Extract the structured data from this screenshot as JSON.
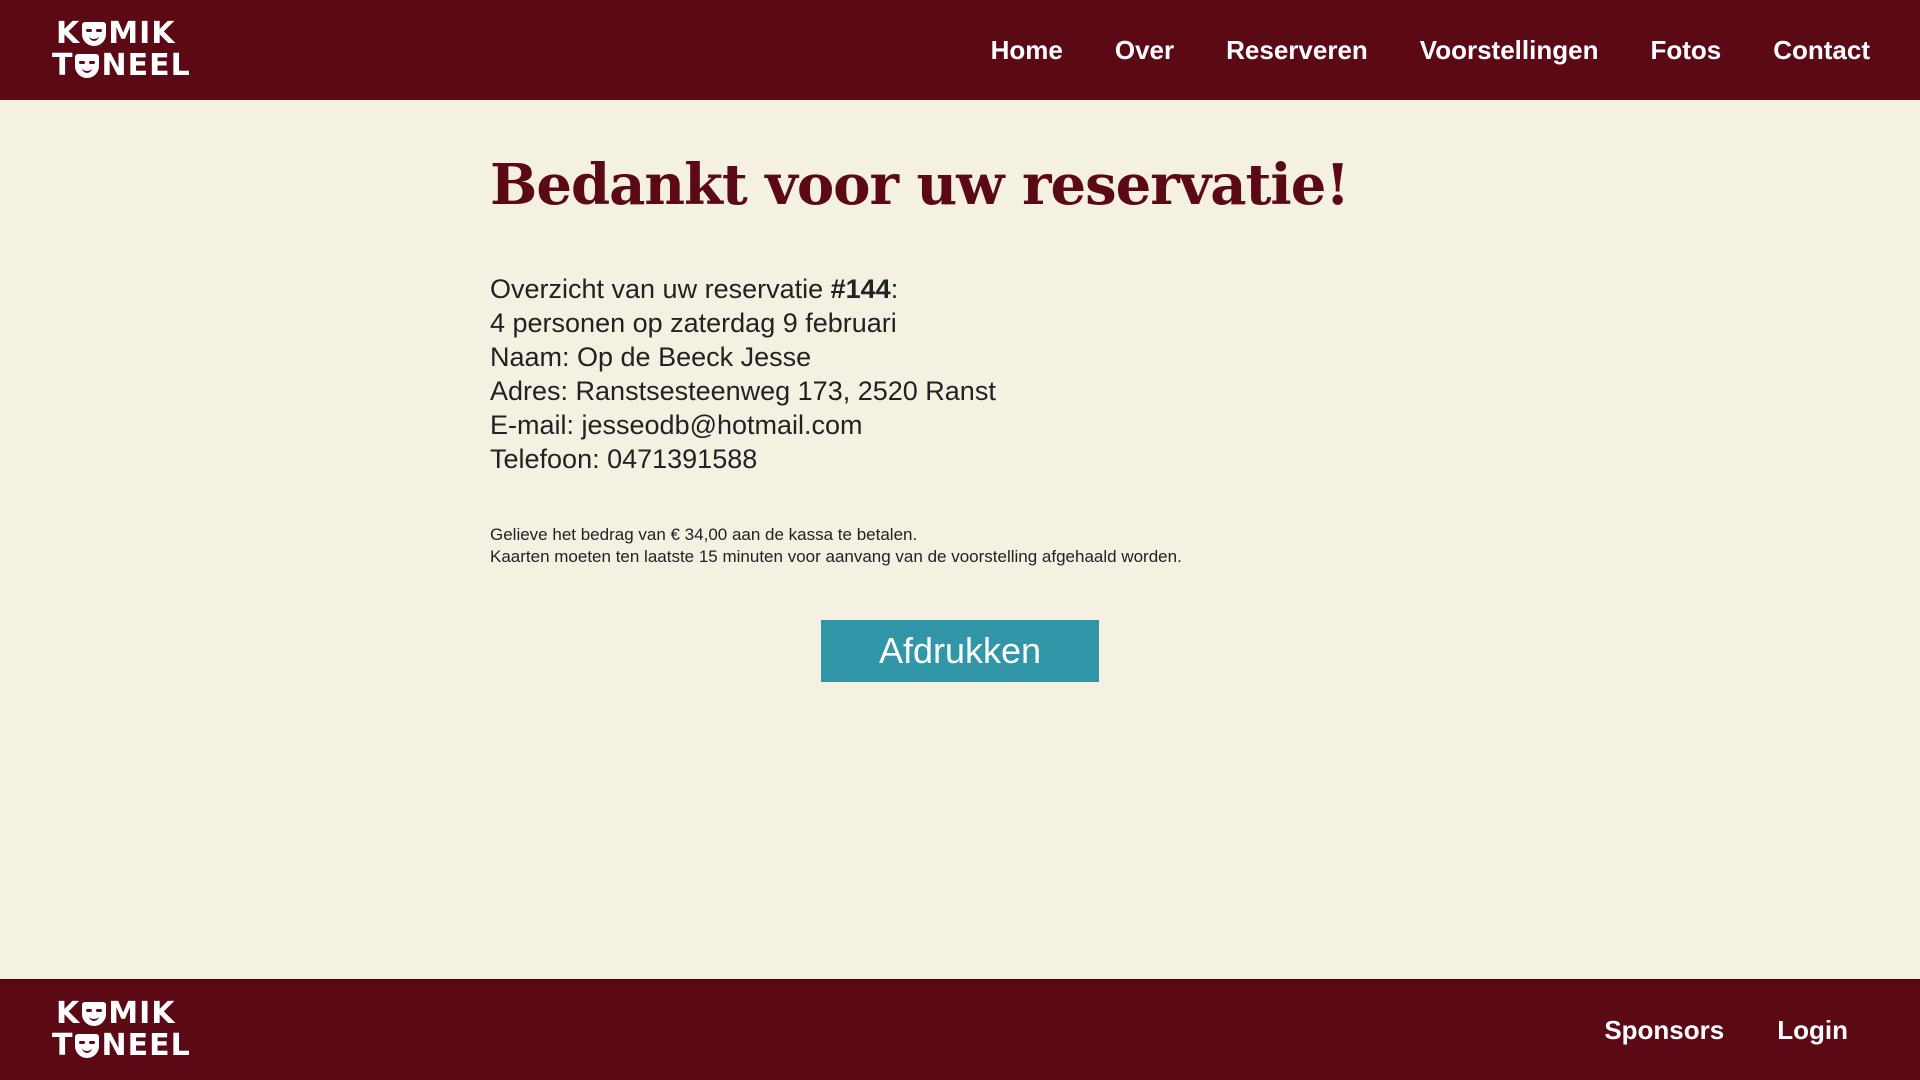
{
  "header": {
    "logo": {
      "line1_a": "K",
      "line1_b": "MIK",
      "line2_a": "T",
      "line2_b": "NEEL"
    },
    "nav": [
      "Home",
      "Over",
      "Reserveren",
      "Voorstellingen",
      "Fotos",
      "Contact"
    ]
  },
  "main": {
    "title": "Bedankt voor uw reservatie!",
    "summary": {
      "intro_prefix": "Overzicht van uw reservatie ",
      "reservation_number": "#144",
      "intro_suffix": ":",
      "people_line": "4 personen op zaterdag 9 februari",
      "name_line": "Naam: Op de Beeck Jesse",
      "address_line": "Adres: Ranstsesteenweg 173, 2520 Ranst",
      "email_line": "E-mail: jesseodb@hotmail.com",
      "phone_line": "Telefoon: 0471391588"
    },
    "notes": {
      "payment": "Gelieve het bedrag van € 34,00 aan de kassa te betalen.",
      "pickup": "Kaarten moeten ten laatste 15 minuten voor aanvang van de voorstelling afgehaald worden."
    },
    "print_button": "Afdrukken"
  },
  "footer": {
    "logo": {
      "line1_a": "K",
      "line1_b": "MIK",
      "line2_a": "T",
      "line2_b": "NEEL"
    },
    "nav": [
      "Sponsors",
      "Login"
    ]
  },
  "colors": {
    "brand": "#5c0916",
    "background": "#f4f1e3",
    "button": "#3096a8",
    "text": "#222222"
  },
  "icons": {
    "logo_mask": "theatre-mask-icon"
  }
}
